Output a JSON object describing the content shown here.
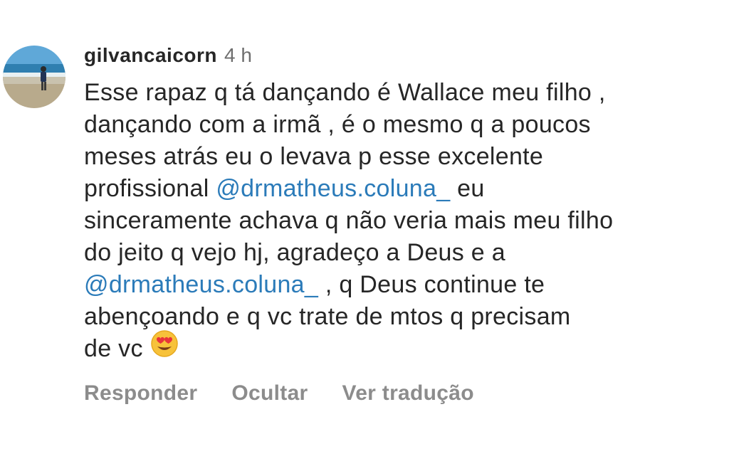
{
  "comment": {
    "username": "gilvancaicorn",
    "time": "4 h",
    "avatar_icon": "beach-photo-avatar",
    "lines": {
      "l1": "Esse rapaz q tá dançando é Wallace meu filho ,",
      "l2": "dançando com a irmã , é o mesmo q a poucos",
      "l3": "meses atrás eu o levava p esse excelente",
      "l4_before": "profissional ",
      "l4_mention": "@drmatheus.coluna_",
      "l4_after": " eu",
      "l5": "sinceramente achava q não veria mais meu filho",
      "l6": "do jeito q vejo hj, agradeço a Deus e a",
      "l7_mention": "@drmatheus.coluna_",
      "l7_after": " , q Deus continue te",
      "l8": "abençoando  e q vc trate de mtos q precisam",
      "l9": "de vc"
    },
    "emoji": "heart-eyes-emoji",
    "mention_color": "#2b7bb9"
  },
  "actions": {
    "reply": "Responder",
    "hide": "Ocultar",
    "translate": "Ver tradução"
  }
}
